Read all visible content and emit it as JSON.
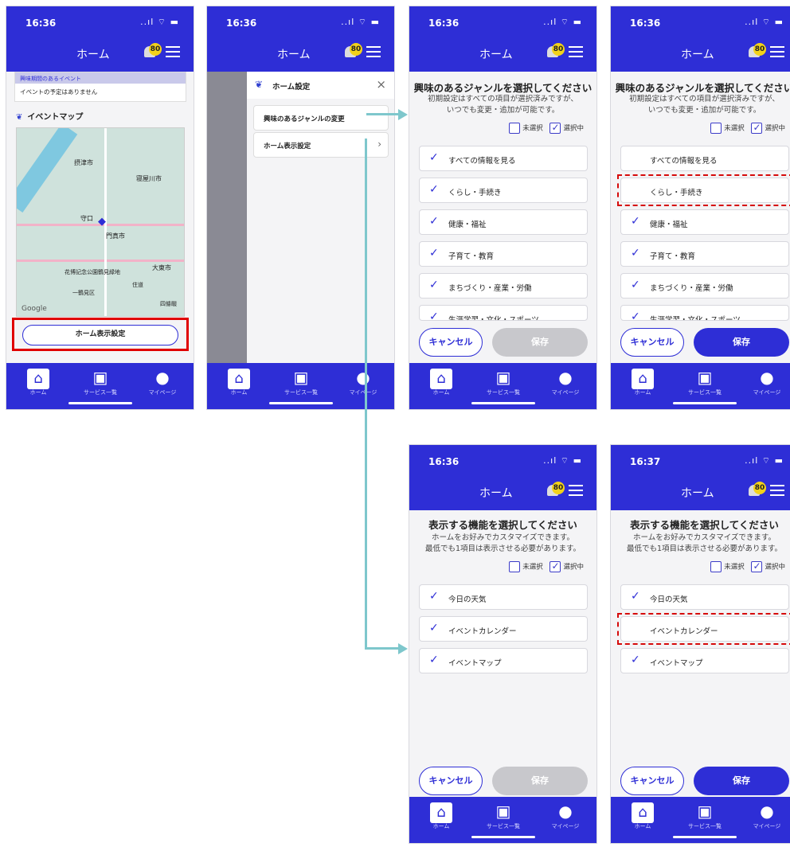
{
  "common": {
    "time": "16:36",
    "time_late": "16:37",
    "signal": "..ıl ⌔ ▬",
    "header_title": "ホーム",
    "badge": "80",
    "nav_home": "ホーム",
    "nav_services": "サービス一覧",
    "nav_mypage": "マイページ",
    "cancel": "キャンセル",
    "save": "保存"
  },
  "screen1": {
    "banner_title": "興味期間のあるイベント",
    "banner_text": "イベントの予定はありません",
    "map_heading": "イベントマップ",
    "map_labels": [
      "摂津市",
      "寝屋川市",
      "守口",
      "門真市",
      "大東市",
      "花博記念公園鶴見緑地",
      "一鶴見区",
      "住道",
      "四條畷",
      "Google"
    ],
    "home_display_button": "ホーム表示設定"
  },
  "screen2": {
    "drawer_title": "ホーム設定",
    "close": "×",
    "item1": "興味のあるジャンルの変更",
    "item2": "ホーム表示設定"
  },
  "genre": {
    "title": "興味のあるジャンルを選択してください",
    "sub1": "初期設定はすべての項目が選択済みですが、",
    "sub2": "いつでも変更・追加が可能です。",
    "unselected": "未選択",
    "selected": "選択中",
    "items": [
      "すべての情報を見る",
      "くらし・手続き",
      "健康・福祉",
      "子育て・教育",
      "まちづくり・産業・労働",
      "生涯学習・文化・スポーツ"
    ]
  },
  "feature": {
    "title": "表示する機能を選択してください",
    "sub1": "ホームをお好みでカスタマイズできます。",
    "sub2": "最低でも1項目は表示させる必要があります。",
    "items": [
      "今日の天気",
      "イベントカレンダー",
      "イベントマップ"
    ]
  },
  "colors": {
    "brand": "#2e2ed6",
    "save_active": "#2e2ed6",
    "save_disabled": "#c8c8cc",
    "highlight_red": "#d60a0a",
    "arrow": "#7ec7cc"
  }
}
